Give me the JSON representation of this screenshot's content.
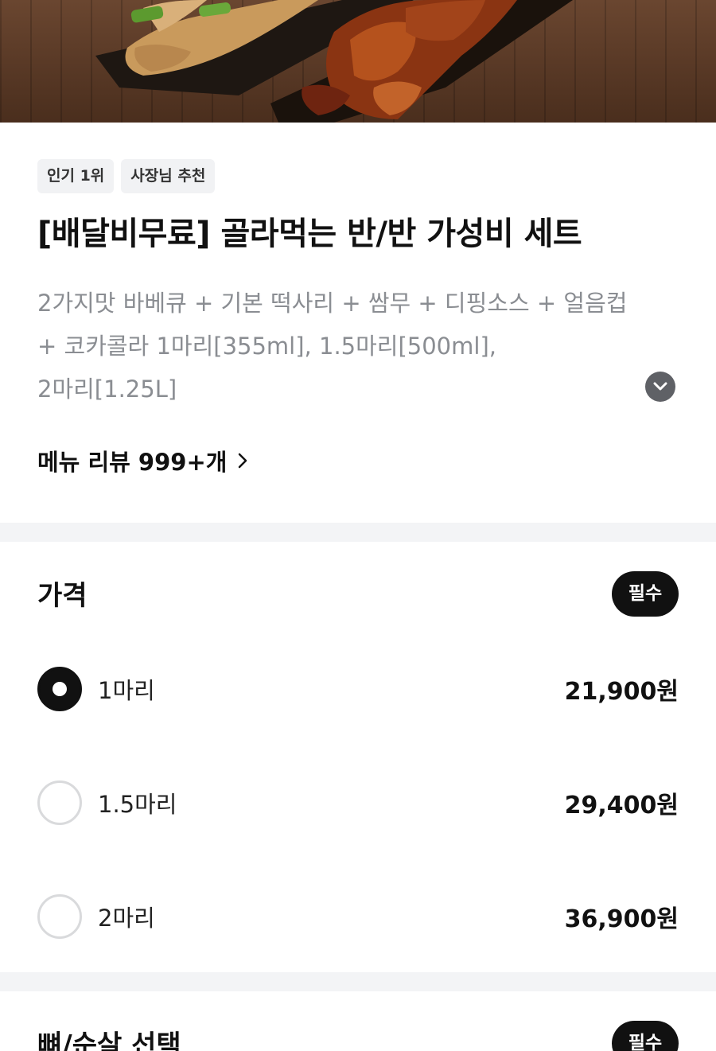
{
  "hero": {
    "image_alt": "바베큐 치킨 두 가지 맛"
  },
  "badges": [
    "인기 1위",
    "사장님 추천"
  ],
  "title": "[배달비무료] 골라먹는 반/반 가성비 세트",
  "description_lines": [
    "2가지맛 바베큐 + 기본 떡사리 + 쌈무 + 디핑소스 + 얼음컵",
    "+ 코카콜라 1마리[355ml], 1.5마리[500ml],",
    "2마리[1.25L]"
  ],
  "review": {
    "label": "메뉴 리뷰 999+개"
  },
  "price_section": {
    "title": "가격",
    "required_label": "필수",
    "options": [
      {
        "label": "1마리",
        "price": "21,900원",
        "selected": true
      },
      {
        "label": "1.5마리",
        "price": "29,400원",
        "selected": false
      },
      {
        "label": "2마리",
        "price": "36,900원",
        "selected": false
      }
    ]
  },
  "bone_section": {
    "title": "뼈/순살 선택",
    "required_label": "필수"
  },
  "colors": {
    "accent": "#111111",
    "muted_text": "#8a8d92",
    "badge_bg": "#f1f2f4",
    "divider": "#f3f4f6"
  }
}
